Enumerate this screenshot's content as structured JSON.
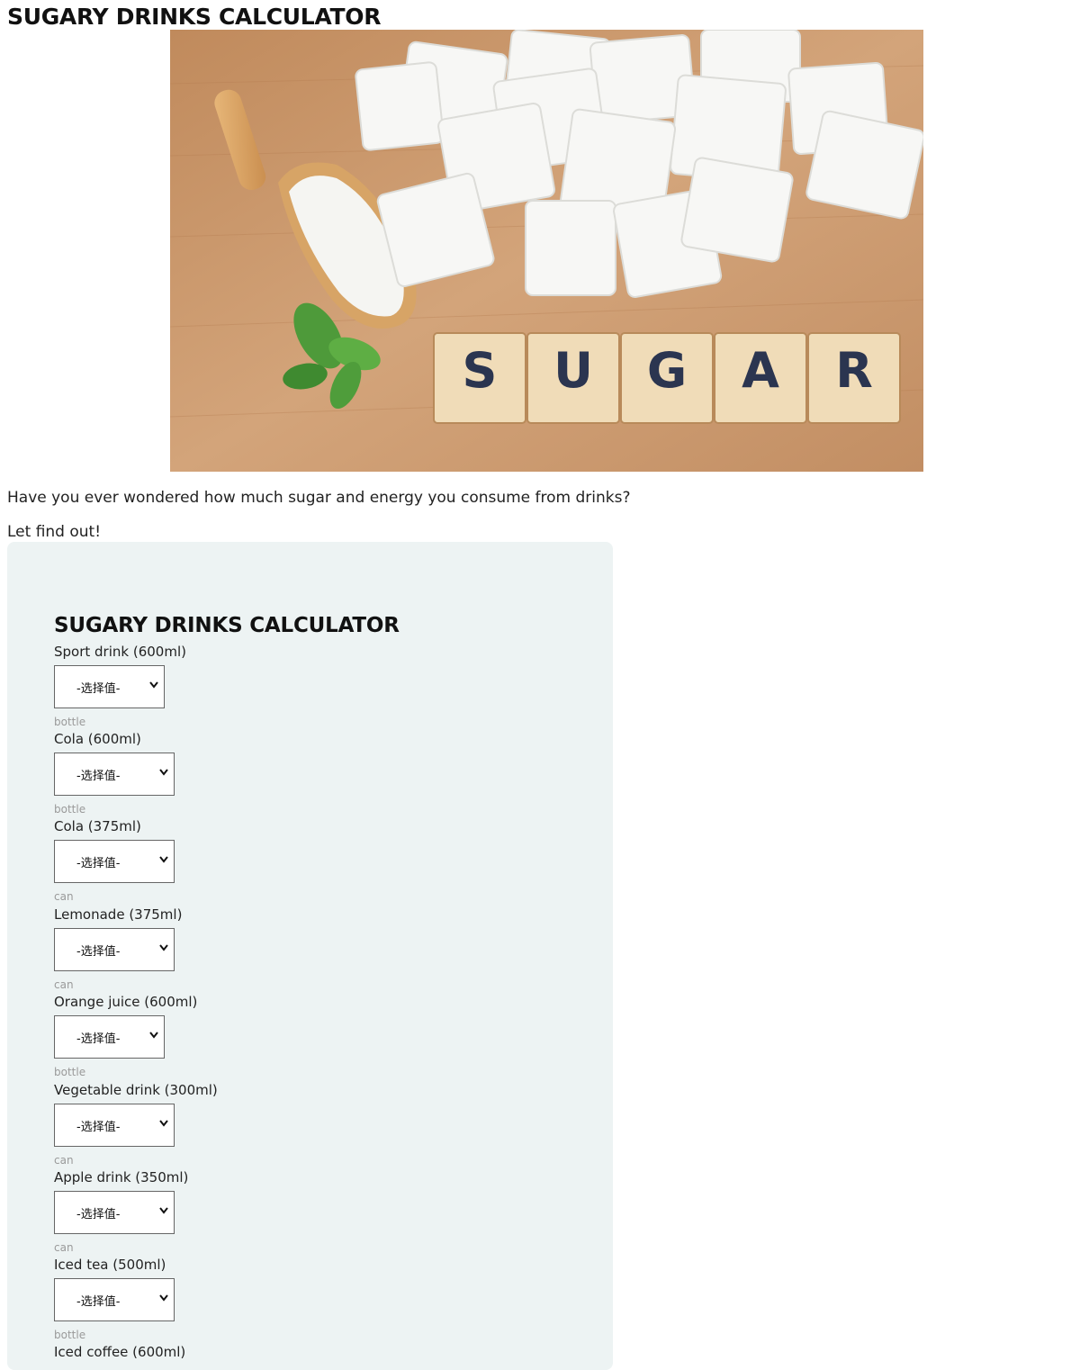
{
  "page": {
    "title": "SUGARY DRINKS CALCULATOR",
    "intro_question": "Have you ever wondered how much sugar and energy you consume from drinks?",
    "intro_cta": "Let find out!"
  },
  "hero_image": {
    "alt": "Sugar cubes and scoop",
    "tiles": [
      "S",
      "U",
      "G",
      "A",
      "R"
    ]
  },
  "calculator": {
    "title": "SUGARY DRINKS CALCULATOR",
    "select_placeholder": "-选择值-",
    "drinks": [
      {
        "label": "Sport drink (600ml)",
        "unit": "bottle"
      },
      {
        "label": "Cola (600ml)",
        "unit": "bottle"
      },
      {
        "label": "Cola (375ml)",
        "unit": "can"
      },
      {
        "label": "Lemonade (375ml)",
        "unit": "can"
      },
      {
        "label": "Orange juice (600ml)",
        "unit": "bottle"
      },
      {
        "label": "Vegetable drink (300ml)",
        "unit": "can"
      },
      {
        "label": "Apple drink (350ml)",
        "unit": "can"
      },
      {
        "label": "Iced tea (500ml)",
        "unit": "bottle"
      },
      {
        "label": "Iced coffee (600ml)",
        "unit": ""
      }
    ]
  },
  "colors": {
    "panel_bg": "#edf3f3",
    "wood": "#c9966a",
    "tile": "#f0dcb8",
    "tile_letter": "#2b3550"
  }
}
